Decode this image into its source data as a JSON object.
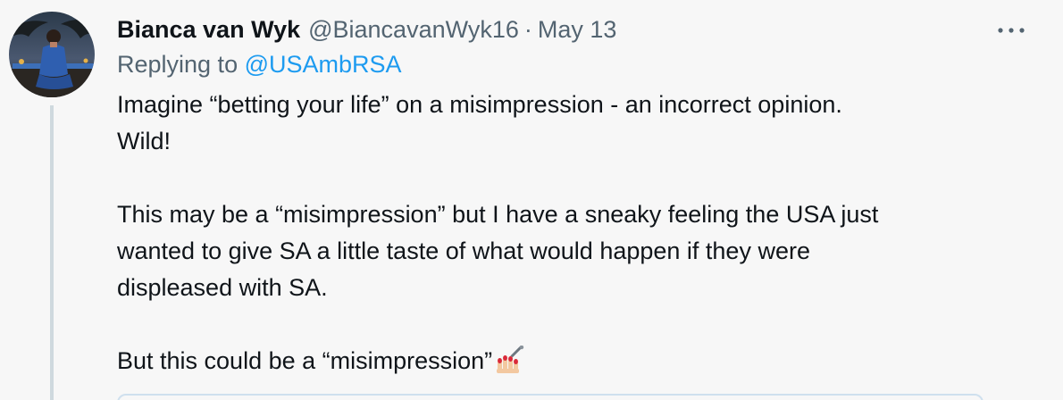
{
  "tweet": {
    "author_name": "Bianca van Wyk",
    "handle": "@BiancavanWyk16",
    "separator": "·",
    "date": "May 13",
    "replying_prefix": "Replying to ",
    "replying_to": "@USAmbRSA",
    "paragraphs": [
      {
        "line1": "Imagine “betting your life” on a misimpression - an incorrect opinion.",
        "line2": "Wild!"
      },
      {
        "line1": "This may be a “misimpression” but I have a sneaky feeling the USA just",
        "line2": "wanted to give SA a little taste of what would happen if they were",
        "line3": "displeased with SA."
      },
      {
        "line1": "But this could be a “misimpression”"
      }
    ],
    "emoji": "nail-polish-icon"
  },
  "colors": {
    "text": "#0f1419",
    "secondary": "#536471",
    "link": "#1d9bf0",
    "background": "#f7f7f7",
    "thread_line": "#cfd9de"
  }
}
